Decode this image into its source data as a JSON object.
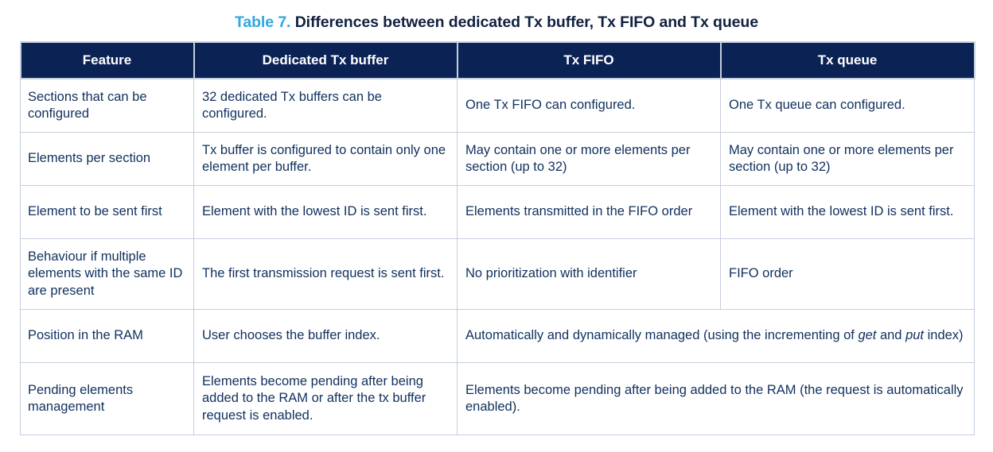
{
  "caption": {
    "number": "Table 7.",
    "title": "Differences between dedicated Tx buffer, Tx FIFO and Tx queue",
    "number_color": "#2ea8df",
    "title_color": "#10213f"
  },
  "table": {
    "header_bg": "#0b2354",
    "header_text_color": "#ffffff",
    "body_text_color": "#10305e",
    "border_color": "#c6cedd",
    "columns": [
      "Feature",
      "Dedicated Tx buffer",
      "Tx FIFO",
      "Tx queue"
    ],
    "rows": [
      {
        "feature": "Sections that can be configured",
        "dedicated": "32 dedicated Tx buffers can be configured.",
        "fifo": "One Tx FIFO can configured.",
        "queue": "One Tx queue can configured.",
        "merged": false
      },
      {
        "feature": "Elements per section",
        "dedicated": "Tx buffer is configured to contain only one element per buffer.",
        "fifo": "May contain one or more elements per section (up to 32)",
        "queue": "May contain one or more elements per section (up to 32)",
        "merged": false
      },
      {
        "feature": "Element to be sent first",
        "dedicated": "Element with the lowest ID is sent first.",
        "fifo": "Elements transmitted in the FIFO order",
        "queue": "Element with the lowest ID is sent first.",
        "merged": false
      },
      {
        "feature": "Behaviour if multiple elements with the same ID are present",
        "dedicated": "The first transmission request is sent first.",
        "fifo": "No prioritization with identifier",
        "queue": "FIFO order",
        "merged": false
      },
      {
        "feature": "Position in the RAM",
        "dedicated": "User chooses the buffer index.",
        "merged_text_pre": "Automatically and dynamically managed (using the incrementing of ",
        "merged_em1": "get",
        "merged_text_mid": " and ",
        "merged_em2": "put",
        "merged_text_post": " index)",
        "merged": true
      },
      {
        "feature": "Pending elements management",
        "dedicated": "Elements become pending after being added to the RAM or after the tx buffer request is enabled.",
        "merged_text_pre": "Elements become pending after being added to the RAM (the request is automatically enabled).",
        "merged_em1": "",
        "merged_text_mid": "",
        "merged_em2": "",
        "merged_text_post": "",
        "merged": true
      }
    ]
  }
}
